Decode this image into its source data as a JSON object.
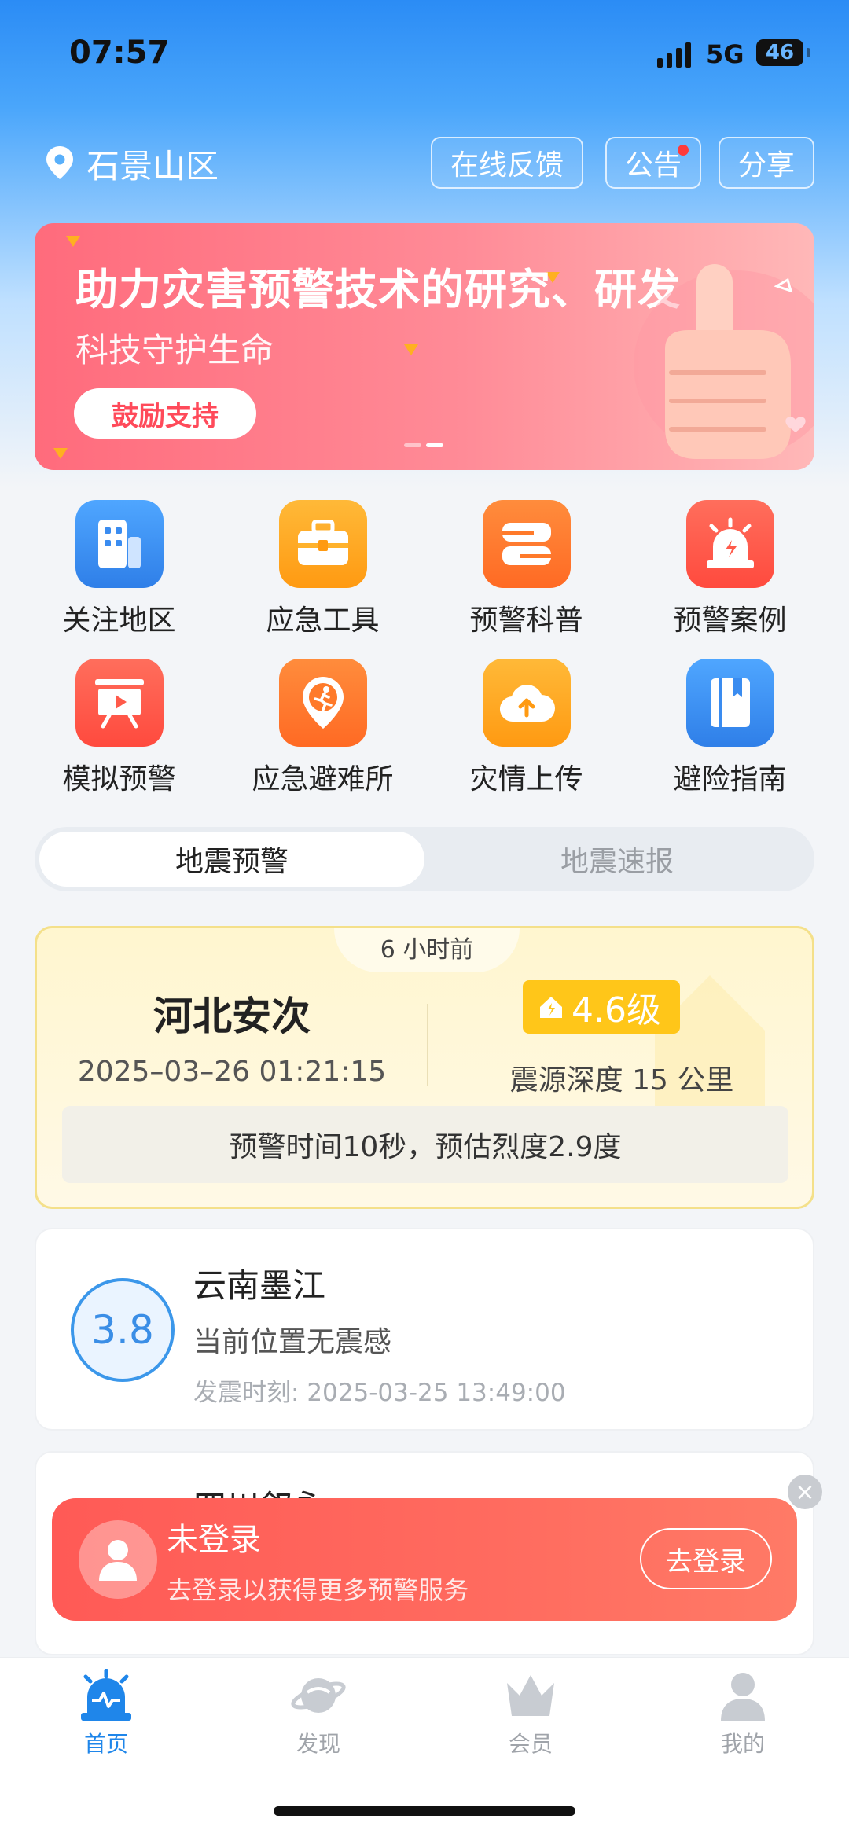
{
  "status": {
    "time": "07:57",
    "network": "5G",
    "battery": "46"
  },
  "header": {
    "location": "石景山区",
    "buttons": {
      "feedback": "在线反馈",
      "notice": "公告",
      "share": "分享"
    }
  },
  "banner": {
    "title": "助力灾害预警技术的研究、研发",
    "subtitle": "科技守护生命",
    "button": "鼓励支持"
  },
  "grid": [
    {
      "label": "关注地区",
      "icon": "buildings-icon",
      "color": "#3b8ff0"
    },
    {
      "label": "应急工具",
      "icon": "toolbox-icon",
      "color": "#ffa41b"
    },
    {
      "label": "预警科普",
      "icon": "book-stack-icon",
      "color": "#ff7a2a"
    },
    {
      "label": "预警案例",
      "icon": "alarm-light-icon",
      "color": "#ff5a4a"
    },
    {
      "label": "模拟预警",
      "icon": "presentation-icon",
      "color": "#ff5a4a"
    },
    {
      "label": "应急避难所",
      "icon": "running-person-icon",
      "color": "#ff7a2a"
    },
    {
      "label": "灾情上传",
      "icon": "cloud-upload-icon",
      "color": "#ffa41b"
    },
    {
      "label": "避险指南",
      "icon": "guide-book-icon",
      "color": "#3b8ff0"
    }
  ],
  "segment": {
    "tab1": "地震预警",
    "tab2": "地震速报"
  },
  "alert": {
    "ago": "6 小时前",
    "place": "河北安次",
    "datetime": "2025–03–26 01:21:15",
    "magnitude": "4.6级",
    "depth": "震源深度 15 公里",
    "summary": "预警时间10秒，预估烈度2.9度"
  },
  "quake": {
    "magnitude": "3.8",
    "place": "云南墨江",
    "feel": "当前位置无震感",
    "time_label": "发震时刻:",
    "time_value": "2025-03-25 13:49:00"
  },
  "partial": {
    "place": "四川叙永"
  },
  "login": {
    "title": "未登录",
    "subtitle": "去登录以获得更多预警服务",
    "button": "去登录"
  },
  "tabs": [
    {
      "label": "首页",
      "active": true
    },
    {
      "label": "发现",
      "active": false
    },
    {
      "label": "会员",
      "active": false
    },
    {
      "label": "我的",
      "active": false
    }
  ]
}
